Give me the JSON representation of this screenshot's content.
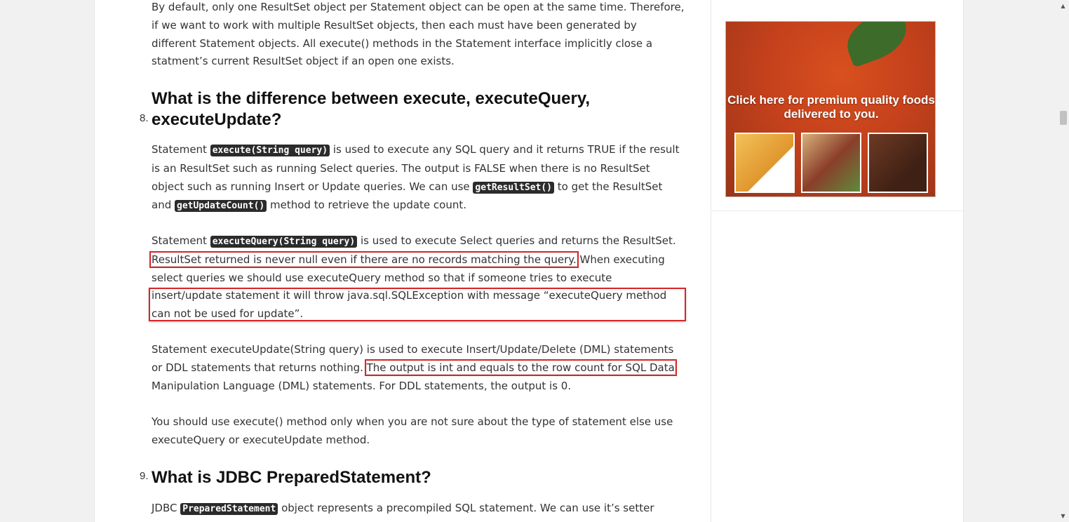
{
  "article": {
    "intro_paragraph": "By default, only one ResultSet object per Statement object can be open at the same time. Therefore, if we want to work with multiple ResultSet objects, then each must have been generated by different Statement objects. All execute() methods in the Statement interface implicitly close a statment’s current ResultSet object if an open one exists.",
    "q8": {
      "number": "8.",
      "title": "What is the difference between execute, executeQuery, executeUpdate?",
      "p1": {
        "t1": "Statement ",
        "c1": "execute(String query)",
        "t2": " is used to execute any SQL query and it returns TRUE if the result is an ResultSet such as running Select queries. The output is FALSE when there is no ResultSet object such as running Insert or Update queries. We can use ",
        "c2": "getResultSet()",
        "t3": " to get the ResultSet and ",
        "c3": "getUpdateCount()",
        "t4": " method to retrieve the update count."
      },
      "p2": {
        "t1": "Statement ",
        "c1": "executeQuery(String query)",
        "t2": " is used to execute Select queries and returns the ResultSet. ",
        "h1": "ResultSet returned is never null even if there are no records matching the query.",
        "t3": " When executing select queries we should use executeQuery method so that if someone tries to execute insert/update statement it will throw java.sql.SQLException with message “executeQuery method can not be used for update”."
      },
      "p3": {
        "t1": "Statement executeUpdate(String query) is used to execute Insert/Update/Delete (DML) statements or DDL statements that returns nothing. ",
        "h1": "The output is int and equals to the row count for SQL Data",
        "t2": " Manipulation Language (DML) statements. For DDL statements, the output is 0."
      },
      "p4": "You should use execute() method only when you are not sure about the type of statement else use executeQuery or executeUpdate method."
    },
    "q9": {
      "number": "9.",
      "title": "What is JDBC PreparedStatement?",
      "p1": {
        "t1": "JDBC ",
        "c1": "PreparedStatement",
        "t2": " object represents a precompiled SQL statement. We can use it’s setter"
      }
    }
  },
  "sidebar": {
    "ad_text": "Click here for premium quality foods delivered to you."
  },
  "scrollbar": {
    "up": "▲",
    "down": "▼"
  },
  "colors": {
    "highlight_box": "#d7262b",
    "code_bg": "#2b2b2b"
  }
}
